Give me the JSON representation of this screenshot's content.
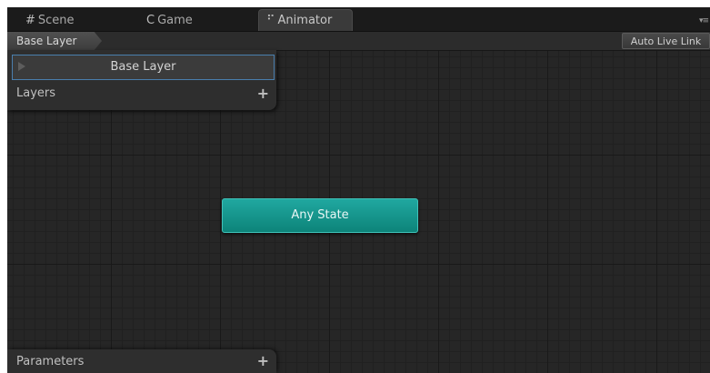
{
  "tabs": [
    {
      "label": "Scene",
      "icon": "grid-icon",
      "glyph": "#",
      "active": false
    },
    {
      "label": "Game",
      "icon": "pacman-icon",
      "glyph": "C",
      "active": false
    },
    {
      "label": "Animator",
      "icon": "animator-icon",
      "glyph": "⠋",
      "active": true
    }
  ],
  "tab_menu_glyph": "▾≡",
  "breadcrumb": {
    "label": "Base Layer"
  },
  "toolbar": {
    "auto_live_link_label": "Auto Live Link"
  },
  "layers_panel": {
    "title": "Layers",
    "add_glyph": "+",
    "items": [
      {
        "label": "Base Layer",
        "icon": "play-icon"
      }
    ]
  },
  "parameters_panel": {
    "title": "Parameters",
    "add_glyph": "+"
  },
  "graph": {
    "nodes": [
      {
        "label": "Any State",
        "color": "#13968d"
      }
    ]
  },
  "colors": {
    "background": "#262626",
    "any_state": "#13968d",
    "selection_border": "#4a7fae"
  }
}
